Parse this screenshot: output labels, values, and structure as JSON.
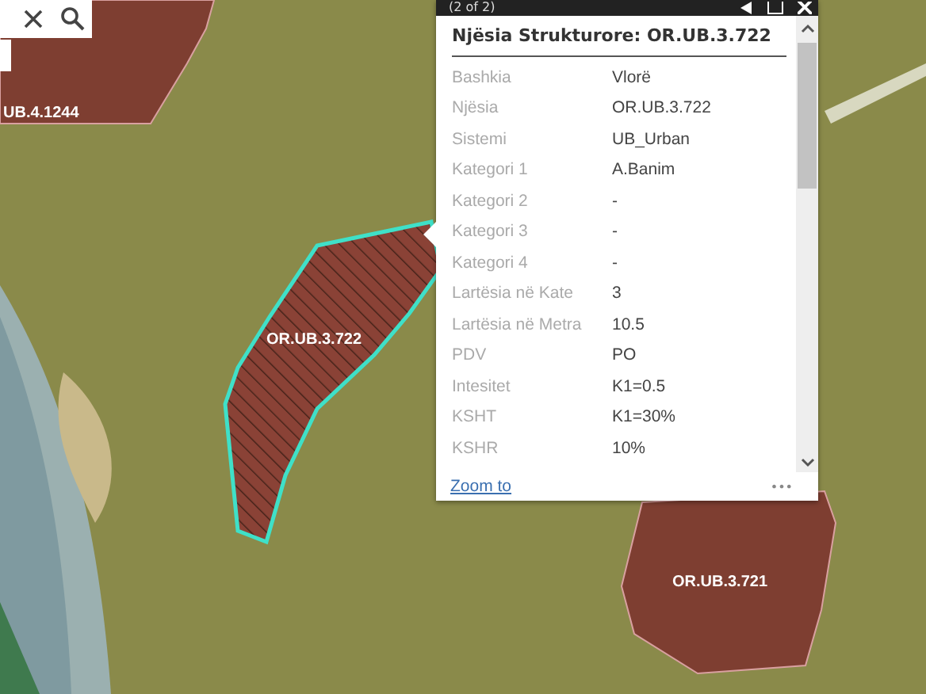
{
  "map": {
    "parcels": [
      {
        "label": "UB.4.1244",
        "selected": false
      },
      {
        "label": "OR.UB.3.722",
        "selected": true
      },
      {
        "label": "OR.UB.3.721",
        "selected": false
      }
    ]
  },
  "popup": {
    "pager": "(2 of 2)",
    "title": "Njësia Strukturore: OR.UB.3.722",
    "fields": [
      {
        "name": "Bashkia",
        "value": "Vlorë"
      },
      {
        "name": "Njësia",
        "value": "OR.UB.3.722"
      },
      {
        "name": "Sistemi",
        "value": "UB_Urban"
      },
      {
        "name": "Kategori 1",
        "value": "A.Banim"
      },
      {
        "name": "Kategori 2",
        "value": "-"
      },
      {
        "name": "Kategori 3",
        "value": "-"
      },
      {
        "name": "Kategori 4",
        "value": "-"
      },
      {
        "name": "Lartësia në Kate",
        "value": "3"
      },
      {
        "name": "Lartësia në Metra",
        "value": "10.5"
      },
      {
        "name": "PDV",
        "value": "PO"
      },
      {
        "name": "Intesitet",
        "value": "K1=0.5"
      },
      {
        "name": "KSHT",
        "value": "K1=30%"
      },
      {
        "name": "KSHR",
        "value": "10%"
      }
    ],
    "zoom_link": "Zoom to",
    "more": "•••"
  }
}
